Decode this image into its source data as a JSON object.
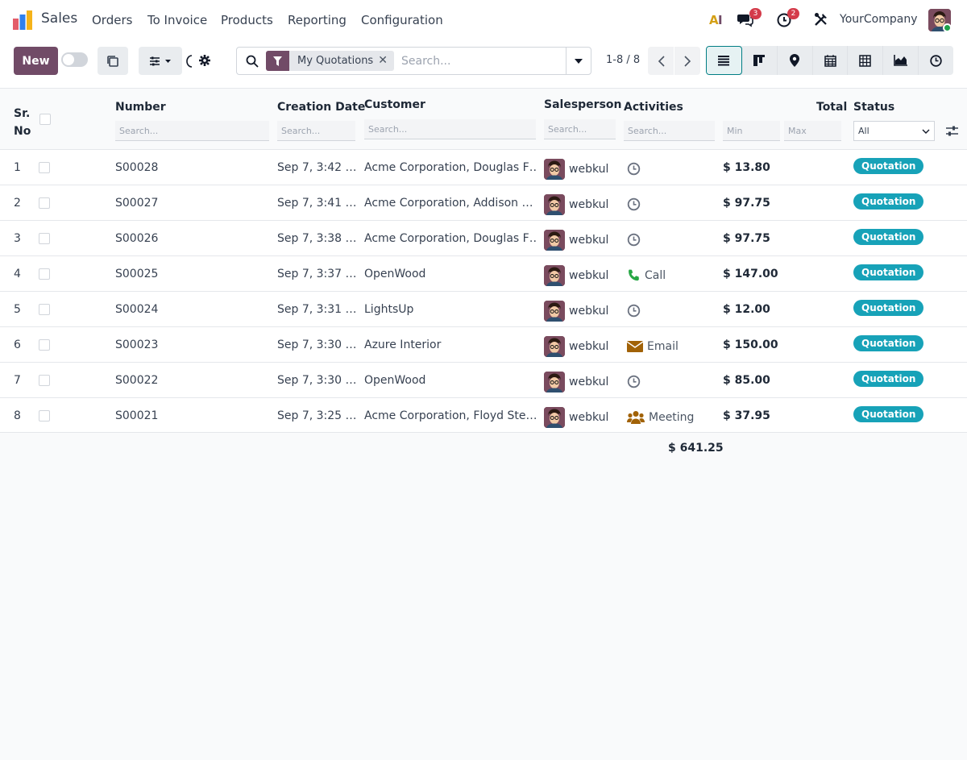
{
  "app": {
    "title": "Sales",
    "brand_colors": [
      "#2f80ed",
      "#e35d6a",
      "#f5b31a"
    ]
  },
  "nav": {
    "items": [
      "Orders",
      "To Invoice",
      "Products",
      "Reporting",
      "Configuration"
    ]
  },
  "systray": {
    "messages_count": "3",
    "activities_count": "2",
    "company": "YourCompany"
  },
  "control_panel": {
    "new_label": "New",
    "facet": {
      "label": "My Quotations"
    },
    "search_placeholder": "Search...",
    "pager": "1-8 / 8",
    "views": [
      "list-view-icon",
      "kanban-view-icon",
      "map-view-icon",
      "calendar-view-icon",
      "pivot-view-icon",
      "graph-view-icon",
      "activity-view-icon"
    ],
    "active_view": "list-view-icon"
  },
  "table": {
    "headers": {
      "sr_no_line1": "Sr.",
      "sr_no_line2": "No",
      "number": "Number",
      "creation_date": "Creation Date",
      "customer": "Customer",
      "salesperson": "Salesperson",
      "activities": "Activities",
      "total": "Total",
      "status": "Status"
    },
    "filters": {
      "search": "Search...",
      "min": "Min",
      "max": "Max",
      "status_selected": "All"
    },
    "rows": [
      {
        "sr": "1",
        "number": "S00028",
        "date": "Sep 7, 3:42 …",
        "customer": "Acme Corporation, Douglas F…",
        "salesperson": "webkul",
        "activity": {
          "icon": "clock-icon",
          "label": ""
        },
        "total": "$ 13.80",
        "status": "Quotation"
      },
      {
        "sr": "2",
        "number": "S00027",
        "date": "Sep 7, 3:41 …",
        "customer": "Acme Corporation, Addison …",
        "salesperson": "webkul",
        "activity": {
          "icon": "clock-icon",
          "label": ""
        },
        "total": "$ 97.75",
        "status": "Quotation"
      },
      {
        "sr": "3",
        "number": "S00026",
        "date": "Sep 7, 3:38 …",
        "customer": "Acme Corporation, Douglas F…",
        "salesperson": "webkul",
        "activity": {
          "icon": "clock-icon",
          "label": ""
        },
        "total": "$ 97.75",
        "status": "Quotation"
      },
      {
        "sr": "4",
        "number": "S00025",
        "date": "Sep 7, 3:37 …",
        "customer": "OpenWood",
        "salesperson": "webkul",
        "activity": {
          "icon": "phone-icon",
          "label": "Call"
        },
        "total": "$ 147.00",
        "status": "Quotation"
      },
      {
        "sr": "5",
        "number": "S00024",
        "date": "Sep 7, 3:31 …",
        "customer": "LightsUp",
        "salesperson": "webkul",
        "activity": {
          "icon": "clock-icon",
          "label": ""
        },
        "total": "$ 12.00",
        "status": "Quotation"
      },
      {
        "sr": "6",
        "number": "S00023",
        "date": "Sep 7, 3:30 …",
        "customer": "Azure Interior",
        "salesperson": "webkul",
        "activity": {
          "icon": "envelope-icon",
          "label": "Email"
        },
        "total": "$ 150.00",
        "status": "Quotation"
      },
      {
        "sr": "7",
        "number": "S00022",
        "date": "Sep 7, 3:30 …",
        "customer": "OpenWood",
        "salesperson": "webkul",
        "activity": {
          "icon": "clock-icon",
          "label": ""
        },
        "total": "$ 85.00",
        "status": "Quotation"
      },
      {
        "sr": "8",
        "number": "S00021",
        "date": "Sep 7, 3:25 …",
        "customer": "Acme Corporation, Floyd Ste…",
        "salesperson": "webkul",
        "activity": {
          "icon": "users-icon",
          "label": "Meeting"
        },
        "total": "$ 37.95",
        "status": "Quotation"
      }
    ],
    "grand_total": "$ 641.25"
  },
  "colors": {
    "brand": "#714b67",
    "status_badge": "#17a2b8",
    "call": "#28a745",
    "email": "#a16207",
    "meeting": "#a16207",
    "clock": "#6b7280"
  }
}
